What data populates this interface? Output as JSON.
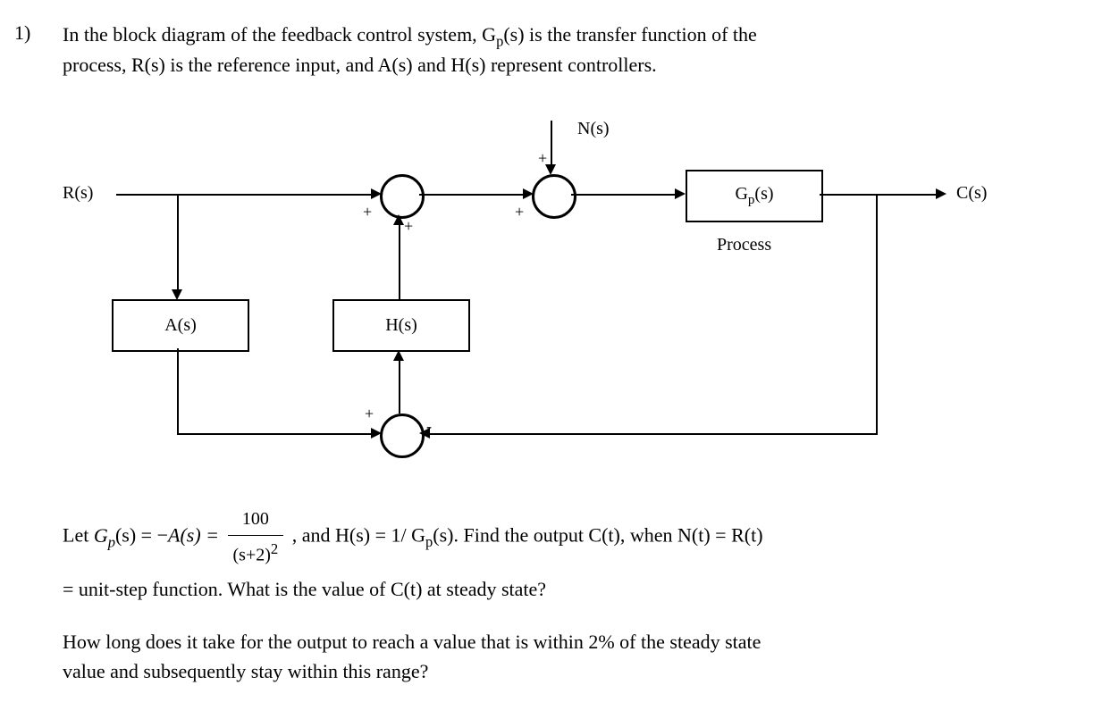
{
  "question_number": "1)",
  "intro_line1_a": "In the block diagram of the feedback control system, G",
  "intro_line1_b": "(s) is the transfer function of the",
  "intro_line2": "process, R(s) is the reference input, and A(s) and H(s) represent controllers.",
  "diagram": {
    "R": "R(s)",
    "N": "N(s)",
    "C": "C(s)",
    "Gp": "G",
    "Gp_s": "(s)",
    "process": "Process",
    "A": "A(s)",
    "H": "H(s)",
    "plus": "+",
    "minus": "-"
  },
  "eq": {
    "let": "Let ",
    "Gp": "G",
    "s_eq": "(s) = −",
    "As": "A(s) = ",
    "frac_num": "100",
    "frac_den_a": "(s",
    "frac_den_b": "+2)",
    "sq": "2",
    "after_frac": " , and H(s) = 1/ G",
    "after_frac2": "(s). Find the output C(t), when N(t) = R(t)",
    "line2": "= unit-step function. What is the value of C(t) at steady state?"
  },
  "q2_line1": "How long does it take for the output to reach a value that is within 2% of the steady state",
  "q2_line2": "value and subsequently stay within this range?",
  "sub_p": "p"
}
